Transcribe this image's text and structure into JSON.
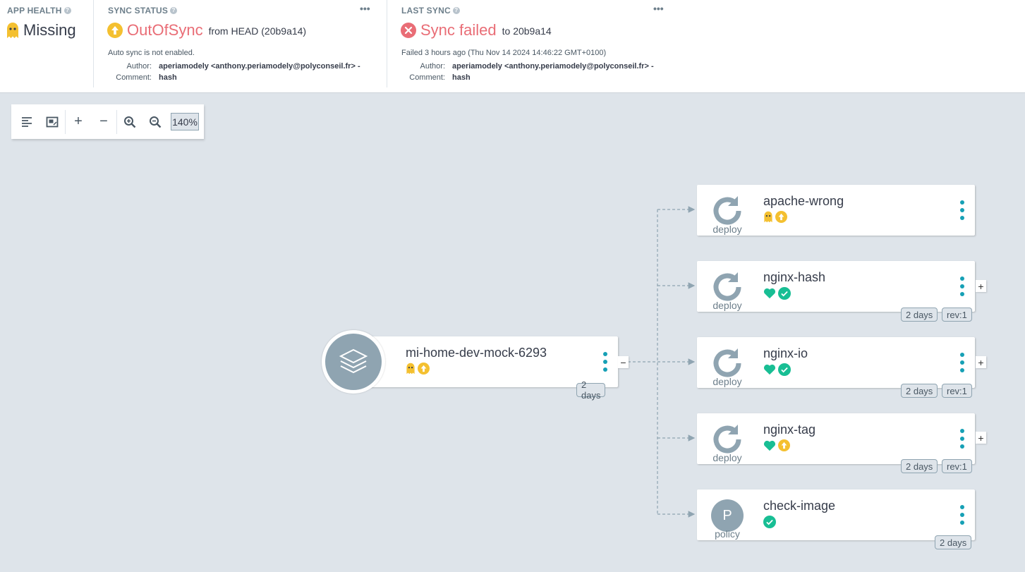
{
  "app_health": {
    "title": "APP HEALTH",
    "status": "Missing",
    "status_color": "#363c4a",
    "icon": "ghost-icon"
  },
  "sync_status": {
    "title": "SYNC STATUS",
    "status": "OutOfSync",
    "status_color": "#e96d76",
    "from": "from HEAD (20b9a14)",
    "auto_sync": "Auto sync is not enabled.",
    "author_label": "Author:",
    "author": "aperiamodely <anthony.periamodely@polyconseil.fr> -",
    "comment_label": "Comment:",
    "comment": "hash",
    "more": "•••"
  },
  "last_sync": {
    "title": "LAST SYNC",
    "status": "Sync failed",
    "status_color": "#e96d76",
    "to": "to 20b9a14",
    "failed_at": "Failed 3 hours ago (Thu Nov 14 2024 14:46:22 GMT+0100)",
    "author_label": "Author:",
    "author": "aperiamodely <anthony.periamodely@polyconseil.fr> -",
    "comment_label": "Comment:",
    "comment": "hash",
    "more": "•••"
  },
  "toolbar": {
    "zoom": "140%",
    "plus": "+",
    "minus": "−"
  },
  "app_node": {
    "name": "mi-home-dev-mock-6293",
    "age": "2 days",
    "collapse": "−"
  },
  "resources": [
    {
      "name": "apache-wrong",
      "kind": "deploy",
      "age": "",
      "rev": ""
    },
    {
      "name": "nginx-hash",
      "kind": "deploy",
      "age": "2 days",
      "rev": "rev:1",
      "expand": "+"
    },
    {
      "name": "nginx-io",
      "kind": "deploy",
      "age": "2 days",
      "rev": "rev:1",
      "expand": "+"
    },
    {
      "name": "nginx-tag",
      "kind": "deploy",
      "age": "2 days",
      "rev": "rev:1",
      "expand": "+"
    },
    {
      "name": "check-image",
      "kind": "policy",
      "age": "2 days",
      "rev": "",
      "letter": "P"
    }
  ],
  "colors": {
    "healthy": "#18be94",
    "missing": "#f4c030",
    "out_of_sync": "#f4c030",
    "failed": "#e96d76",
    "accent": "#16a0b5"
  }
}
